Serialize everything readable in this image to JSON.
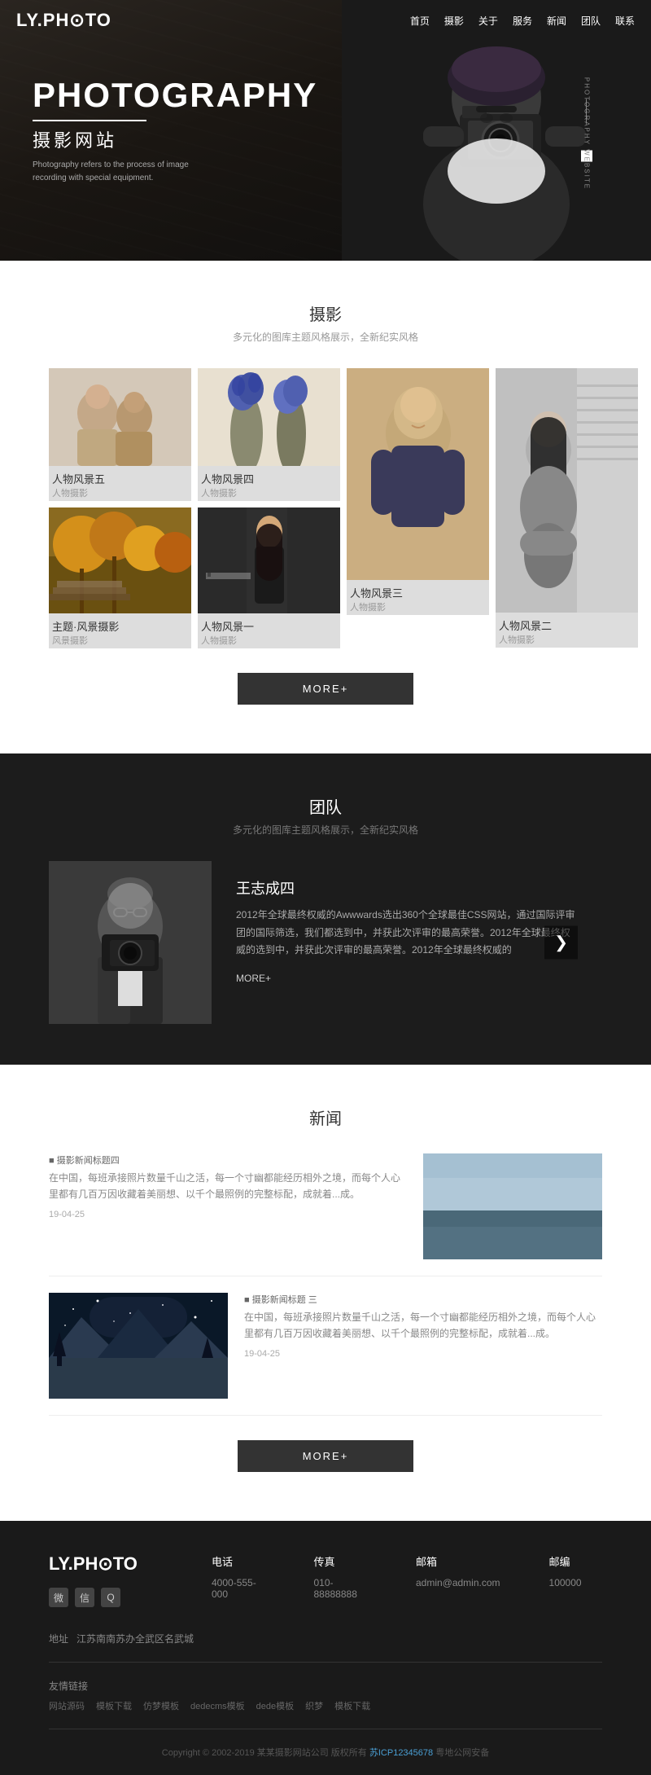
{
  "site": {
    "logo": "LY.PH⊙TO",
    "nav": [
      "首页",
      "摄影",
      "关于",
      "服务",
      "新闻",
      "团队",
      "联系"
    ]
  },
  "hero": {
    "title_en": "PHOTOGRAPHY",
    "title_cn": "摄影网站",
    "subtitle": "Photography refers to the process of image recording with special equipment.",
    "side_text": "PHOTOGRAPHY WEBSITE"
  },
  "photography": {
    "section_title": "摄影",
    "section_subtitle": "多元化的图库主题风格展示，全新纪实风格",
    "photos": [
      {
        "title": "人物风景五",
        "sub": "人物摄影",
        "col": 1,
        "row": 1
      },
      {
        "title": "人物风景四",
        "sub": "人物摄影",
        "col": 2,
        "row": 1
      },
      {
        "title": "人物风景三",
        "sub": "人物摄影",
        "col": 3,
        "row": 1
      },
      {
        "title": "人物风景二",
        "sub": "人物摄影",
        "col": 4,
        "row": 1
      },
      {
        "title": "主题·风景摄影",
        "sub": "风景摄影",
        "col": 1,
        "row": 2
      },
      {
        "title": "人物风景一",
        "sub": "人物摄影",
        "col": 2,
        "row": 2
      }
    ],
    "more_btn": "MORE+"
  },
  "team": {
    "section_title": "团队",
    "section_subtitle": "多元化的图库主题风格展示，全新纪实风格",
    "member": {
      "name": "王志成四",
      "desc": "2012年全球最终权威的Awwwards选出360个全球最佳CSS网站，通过国际评审团的国际筛选，我们都选到中，并获此次评审的最高荣誉。2012年全球最终权威的选到中，并获此次评审的最高荣誉。2012年全球最终权威的",
      "more": "MORE+"
    }
  },
  "news": {
    "section_title": "新闻",
    "items": [
      {
        "icon": "■",
        "title": "摄影新闻标题四",
        "text": "在中国，每班承接照片数量千山之活，每一个寸幽都能经历相外之境，而每个人心里都有几百万因收藏着美丽想、以千个最照例的完整标配，成就着...成。",
        "date": "19-04-25",
        "img_side": "right",
        "img_color": "#6a8a9a"
      },
      {
        "icon": "■",
        "title": "摄影新闻标题 三",
        "text": "在中国，每班承接照片数量千山之活，每一个寸幽都能经历相外之境，而每个人心里都有几百万因收藏着美丽想、以千个最照例的完整标配，成就着...成。",
        "date": "19-04-25",
        "img_side": "left",
        "img_color": "#3a5a8a"
      }
    ],
    "more_btn": "MORE+"
  },
  "footer": {
    "logo": "LY.PH⊙TO",
    "columns": [
      {
        "title": "电话",
        "items": [
          "4000-555-000"
        ]
      },
      {
        "title": "传真",
        "items": [
          "010-88888888"
        ]
      },
      {
        "title": "邮箱",
        "items": [
          "admin@admin.com"
        ]
      },
      {
        "title": "邮编",
        "items": [
          "100000"
        ]
      }
    ],
    "address_label": "地址",
    "address": "江苏南南苏办全武区名武城",
    "links_title": "友情链接",
    "links": [
      {
        "text": "网站源码",
        "highlight": false
      },
      {
        "text": "模板下载",
        "highlight": false
      },
      {
        "text": "仿梦模板",
        "highlight": false
      },
      {
        "text": "dedecms模板",
        "highlight": false
      },
      {
        "text": "dede模板",
        "highlight": false
      },
      {
        "text": "织梦",
        "highlight": false
      },
      {
        "text": "模板下载",
        "highlight": false
      }
    ],
    "copyright": "Copyright © 2002-2019 某某摄影网站公司 版权所有",
    "icp": "苏ICP12345678",
    "legal": "粤地公网安备"
  }
}
